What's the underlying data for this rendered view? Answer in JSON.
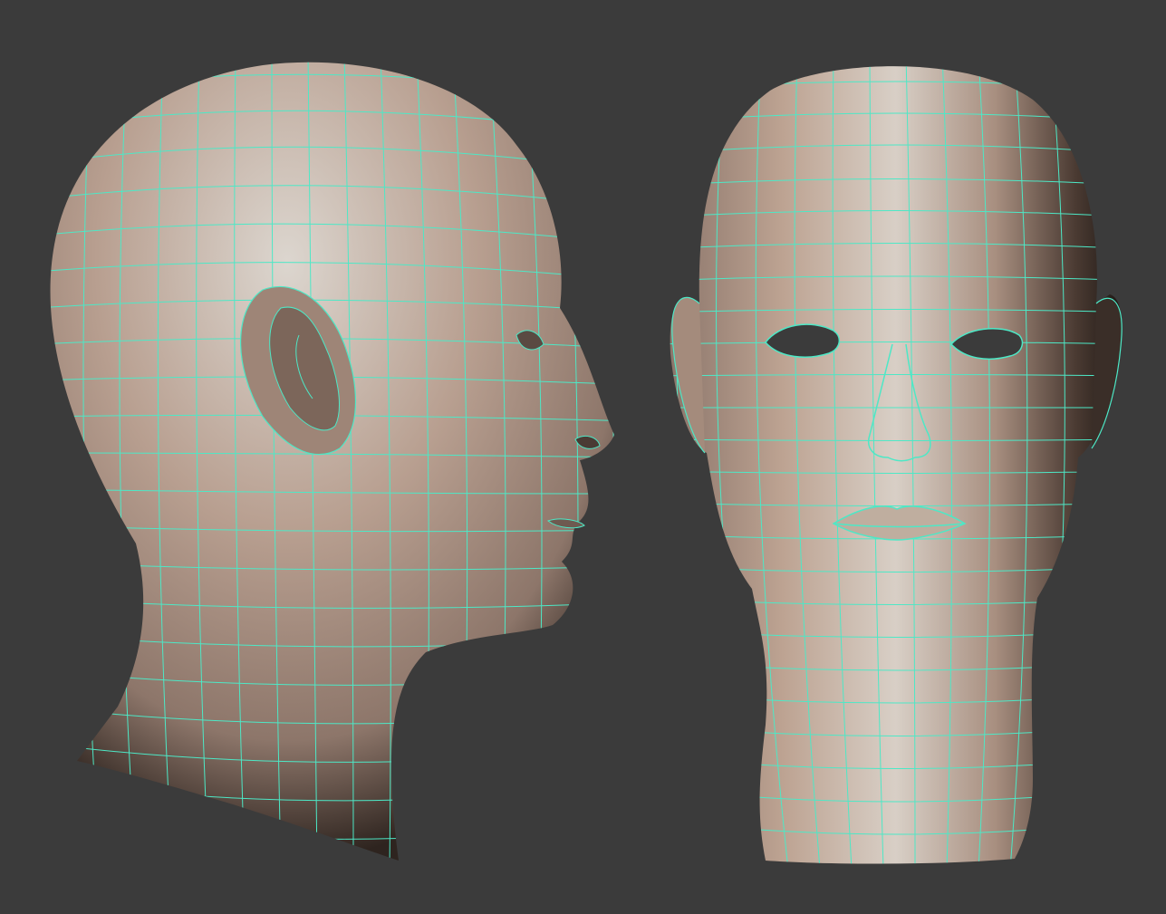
{
  "viewport": {
    "background_color": "#3b3b3b"
  },
  "models": [
    {
      "view": "side",
      "description_visible": false
    },
    {
      "view": "front",
      "description_visible": false
    }
  ],
  "colors": {
    "skin_light": "#dcd6cf",
    "skin_mid": "#b49a8a",
    "skin_dark": "#2a211c",
    "wireframe": "#4de8c6"
  }
}
